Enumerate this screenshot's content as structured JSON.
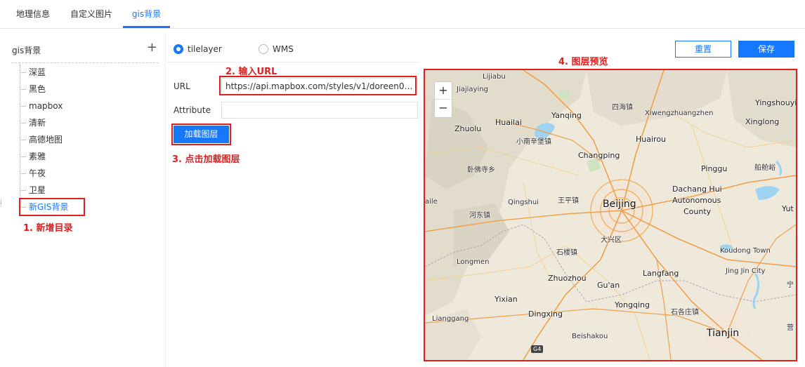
{
  "tabs": [
    {
      "label": "地理信息"
    },
    {
      "label": "自定义图片"
    },
    {
      "label": "gis背景"
    }
  ],
  "sidebar": {
    "title": "gis背景",
    "add_symbol": "+",
    "items": [
      {
        "label": "深蓝"
      },
      {
        "label": "黑色"
      },
      {
        "label": "mapbox"
      },
      {
        "label": "清新"
      },
      {
        "label": "高德地图"
      },
      {
        "label": "素雅"
      },
      {
        "label": "午夜"
      },
      {
        "label": "卫星"
      },
      {
        "label": "新GIS背景"
      }
    ]
  },
  "form": {
    "radio_tilelayer": "tilelayer",
    "radio_wms": "WMS",
    "selected": "tilelayer",
    "url_label": "URL",
    "url_value": "https://api.mapbox.com/styles/v1/doreen081...",
    "attribute_label": "Attribute",
    "attribute_value": "",
    "load_button": "加载图层"
  },
  "actions": {
    "reset": "重置",
    "save": "保存"
  },
  "annotations": {
    "step1": "1. 新增目录",
    "step2": "2. 输入URL",
    "step3": "3. 点击加载图层",
    "step4": "4. 图层预览"
  },
  "map": {
    "zoom_in": "+",
    "zoom_out": "−",
    "places": {
      "lijiabu": "Lijiabu",
      "jiajiaying": "Jiajiaying",
      "sihaizhen": "四海镇",
      "yingshouyi": "Yingshouyi",
      "yanqing": "Yanqing",
      "xiwengzhuang": "Xiwengzhuangzhen",
      "huailai": "Huailai",
      "zhuolu": "Zhuolu",
      "xinan": "小南辛堡镇",
      "xinglong": "Xinglong",
      "huairou": "Huairou",
      "changping": "Changping",
      "wofosi": "卧佛寺乡",
      "pinggu": "Pinggu",
      "liangeyu": "船舱峪",
      "wangping": "王平镇",
      "qingshui": "Qingshui",
      "dachang": "Dachang Hui",
      "autonomous": "Autonomous",
      "county": "County",
      "beijing": "Beijing",
      "hedong": "河东镇",
      "yut": "Yut",
      "daxing": "大兴区",
      "shilou": "石楼镇",
      "koudong": "Koudong Town",
      "longmen": "Longmen",
      "langfang": "Langfang",
      "jingjin": "Jing Jin City",
      "zhuozhou": "Zhuozhou",
      "guan": "Gu'an",
      "yixian": "Yixian",
      "yongqing": "Yongqing",
      "dingxing": "Dingxing",
      "shigezhuang": "石各庄镇",
      "lianggang": "Lianggang",
      "tianjin": "Tianjin",
      "beishakou": "Beishakou",
      "g4": "G4",
      "ning": "宁",
      "ying": "营",
      "ailz": "aile"
    }
  },
  "colors": {
    "accent": "#1677ff",
    "annotation": "#e02020"
  }
}
